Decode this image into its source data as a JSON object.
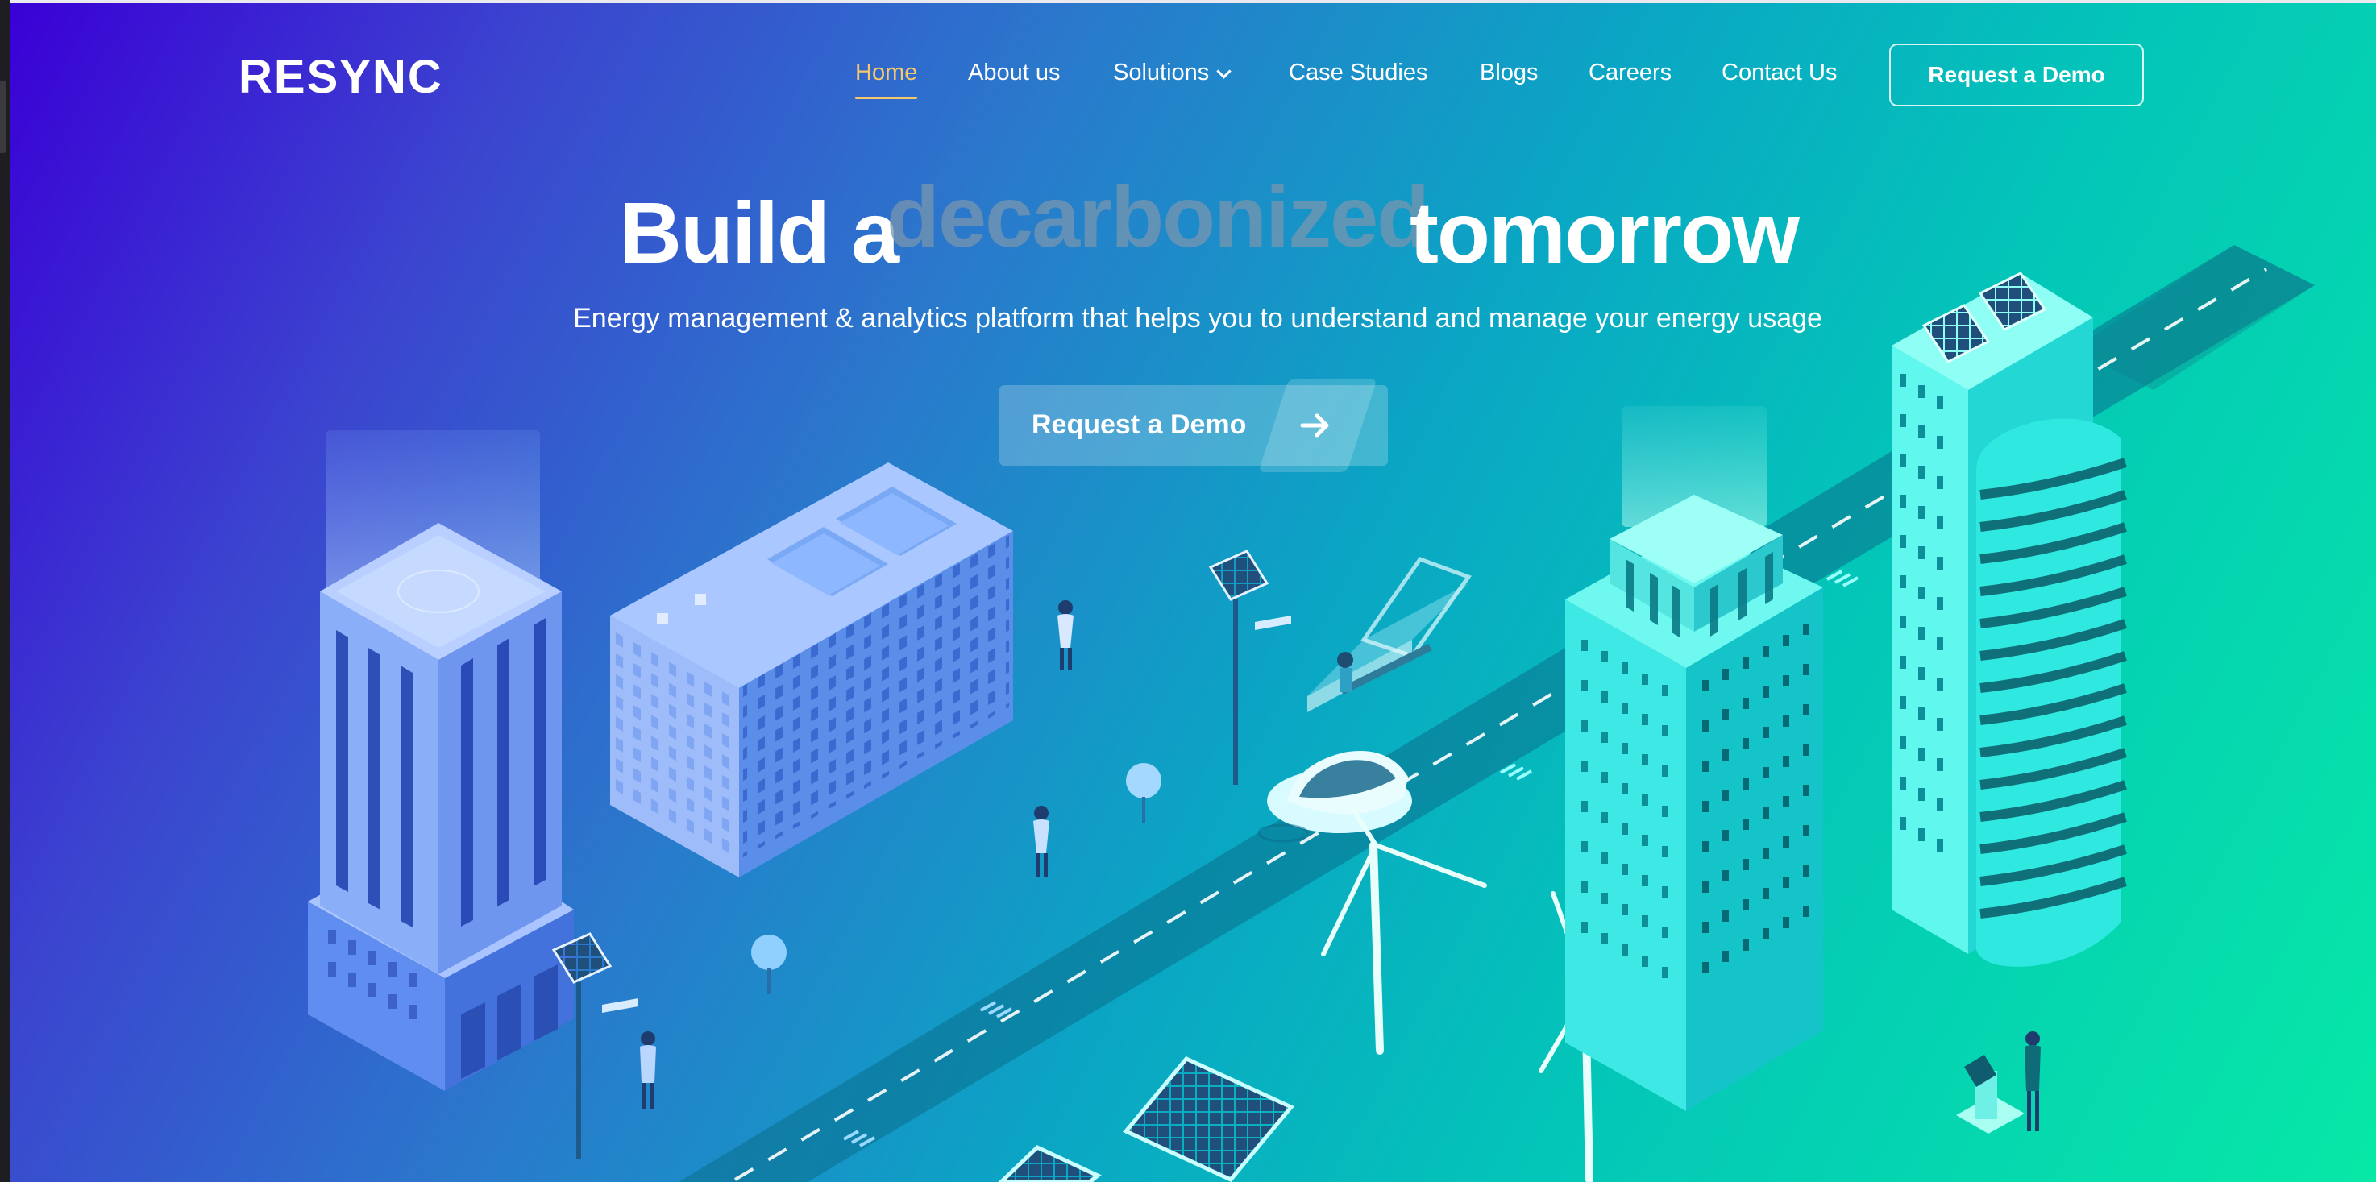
{
  "brand": {
    "logo_text": "RESYNC"
  },
  "nav": {
    "items": [
      {
        "label": "Home",
        "active": true
      },
      {
        "label": "About us",
        "active": false
      },
      {
        "label": "Solutions",
        "active": false,
        "has_dropdown": true
      },
      {
        "label": "Case Studies",
        "active": false
      },
      {
        "label": "Blogs",
        "active": false
      },
      {
        "label": "Careers",
        "active": false
      },
      {
        "label": "Contact Us",
        "active": false
      }
    ],
    "cta_label": "Request a Demo"
  },
  "hero": {
    "headline_start": "Build a",
    "headline_rotating_word": "decarbonized",
    "headline_end": "tomorrow",
    "subtitle": "Energy management & analytics platform that helps you to understand and manage your energy usage",
    "cta_label": "Request a Demo"
  },
  "colors": {
    "gradient_start": "#3a00d6",
    "gradient_mid": "#0aa6c4",
    "gradient_end": "#07e8a6",
    "active_nav": "#f6c86a",
    "text": "#ffffff"
  },
  "icons": {
    "dropdown": "chevron-down-icon",
    "cta_arrow": "arrow-right-icon"
  }
}
